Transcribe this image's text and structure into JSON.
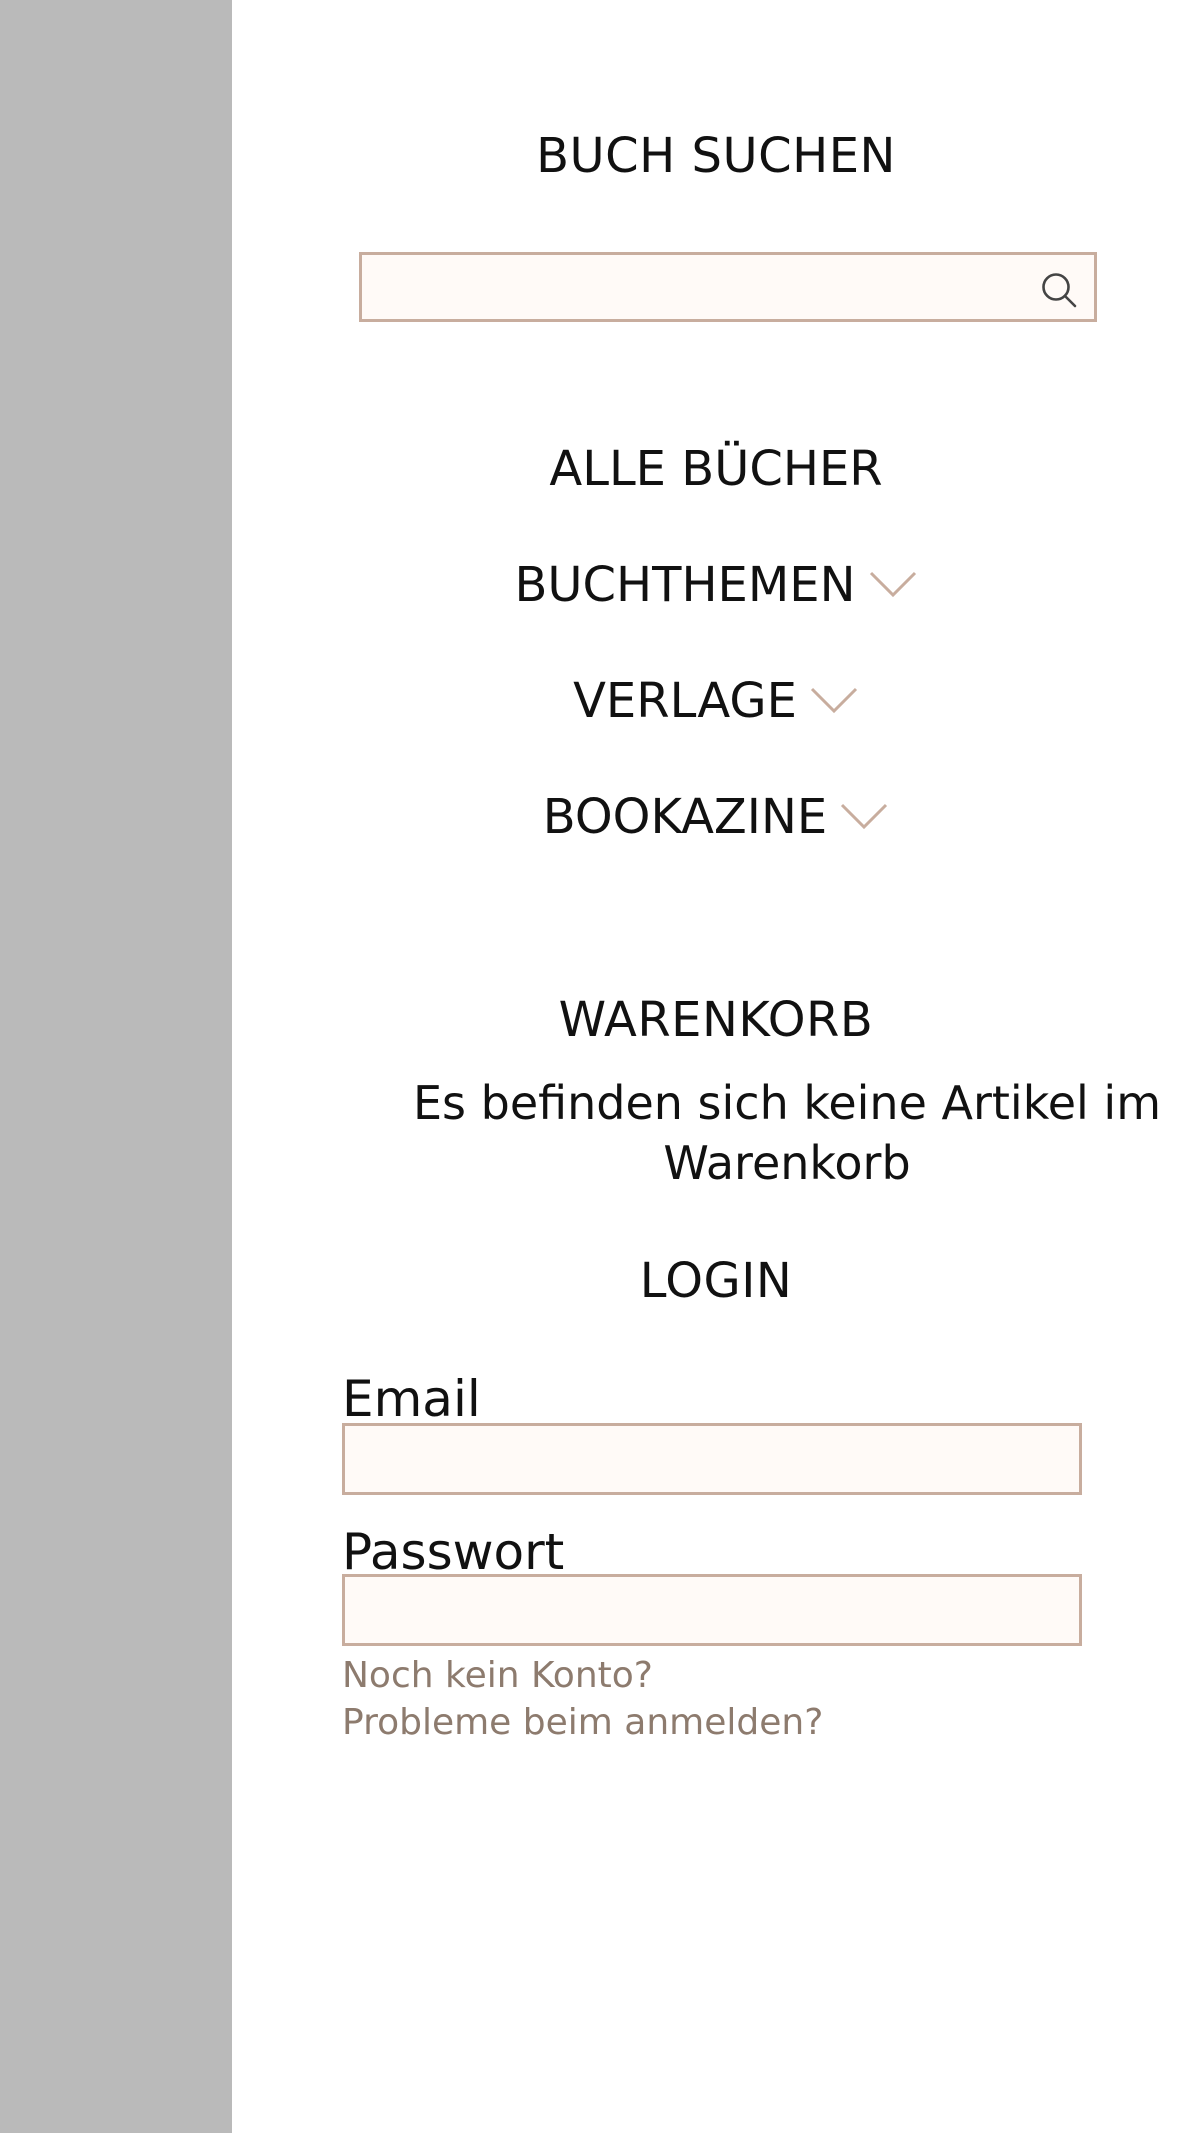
{
  "search": {
    "heading": "BUCH SUCHEN",
    "input_value": "",
    "icon": "search-icon"
  },
  "nav": {
    "items": [
      {
        "label": "ALLE BÜCHER",
        "has_dropdown": false
      },
      {
        "label": "BUCHTHEMEN",
        "has_dropdown": true,
        "icon": "chevron-down-icon"
      },
      {
        "label": "VERLAGE",
        "has_dropdown": true,
        "icon": "chevron-down-icon"
      },
      {
        "label": "BOOKAZINE",
        "has_dropdown": true,
        "icon": "chevron-down-icon"
      }
    ]
  },
  "cart": {
    "heading": "WARENKORB",
    "empty_message": "Es befinden sich keine Artikel im Warenkorb"
  },
  "login": {
    "heading": "LOGIN",
    "email_label": "Email",
    "email_value": "",
    "password_label": "Passwort",
    "password_value": "",
    "register_link": "Noch kein Konto?",
    "problems_link": "Probleme beim anmelden?"
  },
  "colors": {
    "overlay": "#bababa",
    "input_border": "#c8ad9e",
    "input_background": "#fffaf7",
    "link_text": "#8d7b6e",
    "chevron": "#c8ad9e"
  }
}
